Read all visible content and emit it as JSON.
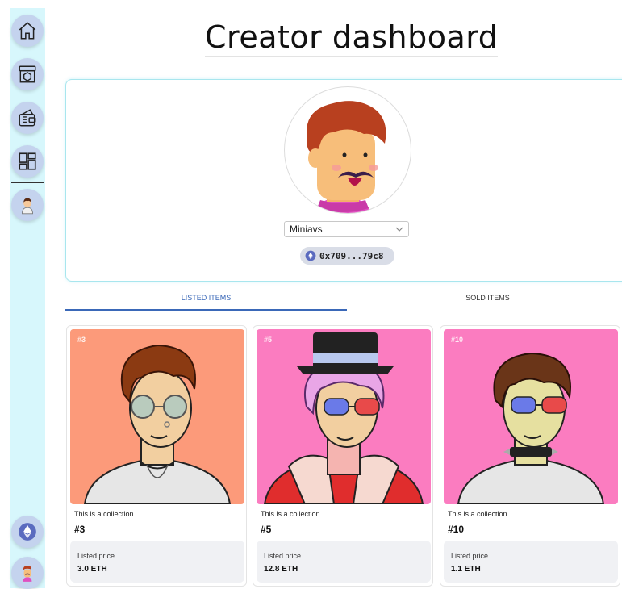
{
  "page": {
    "title": "Creator dashboard"
  },
  "sidebar": {
    "items": [
      {
        "icon": "home-icon"
      },
      {
        "icon": "marketplace-icon"
      },
      {
        "icon": "wallet-icon"
      },
      {
        "icon": "dashboard-icon"
      },
      {
        "icon": "avatar-icon"
      }
    ],
    "bottom": [
      {
        "icon": "ethereum-icon"
      },
      {
        "icon": "profile-avatar-icon"
      }
    ]
  },
  "profile": {
    "selected_profile": "Miniavs",
    "address": "0x709...79c8",
    "colors": {
      "hair": "#b8401f",
      "skin": "#f7be7a",
      "shirt": "#e04fc0"
    }
  },
  "tabs": [
    {
      "label": "LISTED ITEMS",
      "active": true
    },
    {
      "label": "SOLD ITEMS",
      "active": false
    }
  ],
  "items": [
    {
      "badge": "#3",
      "collection": "This is a collection",
      "name": "#3",
      "price_label": "Listed price",
      "price": "3.0 ETH",
      "bg": "#fc9a7a"
    },
    {
      "badge": "#5",
      "collection": "This is a collection",
      "name": "#5",
      "price_label": "Listed price",
      "price": "12.8 ETH",
      "bg": "#fb7cc0"
    },
    {
      "badge": "#10",
      "collection": "This is a collection",
      "name": "#10",
      "price_label": "Listed price",
      "price": "1.1 ETH",
      "bg": "#fb7cc0"
    }
  ]
}
